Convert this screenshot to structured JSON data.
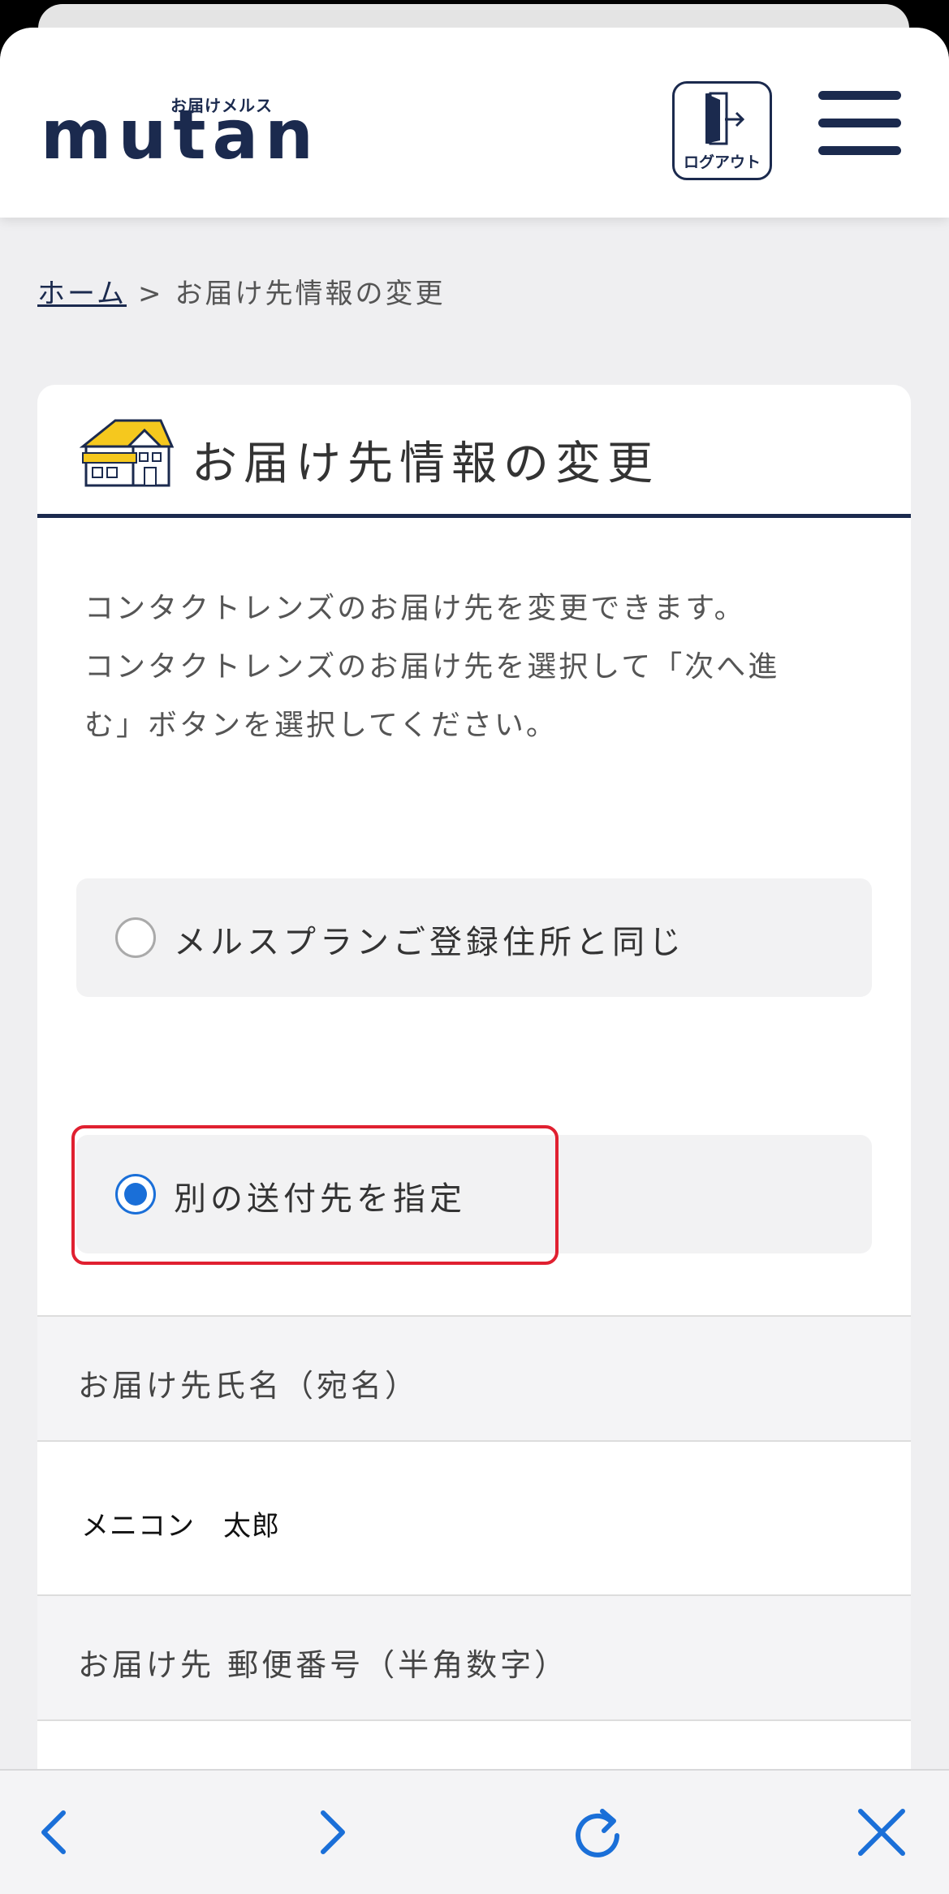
{
  "header": {
    "logo_sub": "お届けメルス",
    "logo_main": "mutan",
    "logout_label": "ログアウト",
    "menu_icon": "hamburger-menu-icon",
    "brand_color": "#1b2a4e"
  },
  "breadcrumb": {
    "home": "ホーム",
    "separator": ">",
    "current": "お届け先情報の変更"
  },
  "card": {
    "title": "お届け先情報の変更",
    "title_icon": "house-icon",
    "description": [
      "コンタクトレンズのお届け先を変更できます。",
      "コンタクトレンズのお届け先を選択して「次へ進",
      "む」ボタンを選択してください。"
    ]
  },
  "options": [
    {
      "label": "メルスプランご登録住所と同じ",
      "selected": false
    },
    {
      "label": "別の送付先を指定",
      "selected": true
    }
  ],
  "form": {
    "name_heading": "お届け先氏名（宛名）",
    "name_value": "メニコン　太郎",
    "zip_heading": "お届け先 郵便番号（半角数字）",
    "zip_value_1": "",
    "zip_value_2": ""
  },
  "toolbar": {
    "back_icon": "chevron-left-icon",
    "forward_icon": "chevron-right-icon",
    "reload_icon": "reload-icon",
    "close_icon": "close-icon",
    "accent_color": "#1a6fd8"
  },
  "colors": {
    "highlight": "#e02030",
    "radio_selected": "#1a6fd8"
  }
}
